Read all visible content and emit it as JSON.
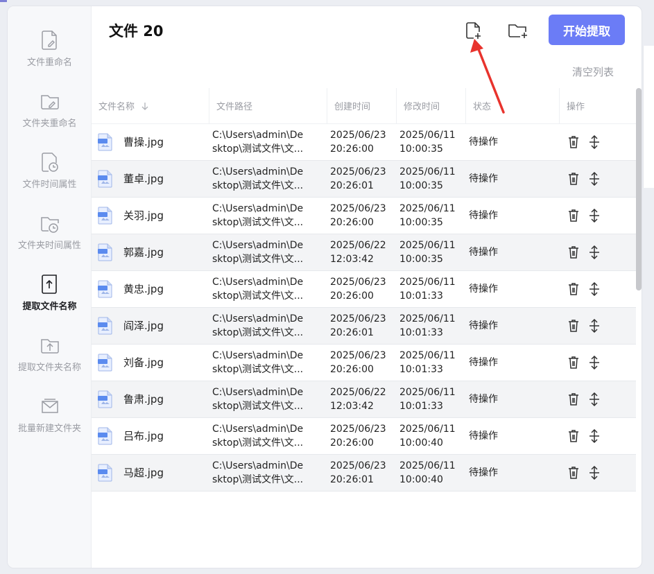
{
  "colors": {
    "accent": "#6b7cf6",
    "arrow": "#e8332d"
  },
  "sidebar": {
    "items": [
      {
        "label": "文件重命名",
        "icon": "file-edit-icon",
        "active": false
      },
      {
        "label": "文件夹重命名",
        "icon": "folder-edit-icon",
        "active": false
      },
      {
        "label": "文件时间属性",
        "icon": "file-clock-icon",
        "active": false
      },
      {
        "label": "文件夹时间属性",
        "icon": "folder-clock-icon",
        "active": false
      },
      {
        "label": "提取文件名称",
        "icon": "file-upload-icon",
        "active": true
      },
      {
        "label": "提取文件夹名称",
        "icon": "folder-upload-icon",
        "active": false
      },
      {
        "label": "批量新建文件夹",
        "icon": "mail-folder-icon",
        "active": false
      }
    ]
  },
  "header": {
    "title": "文件 20",
    "add_file_icon": "file-plus-icon",
    "add_folder_icon": "folder-plus-icon",
    "start_label": "开始提取",
    "clear_label": "清空列表"
  },
  "table": {
    "columns": [
      "文件名称",
      "文件路径",
      "创建时间",
      "修改时间",
      "状态",
      "操作"
    ],
    "rows": [
      {
        "name": "曹操.jpg",
        "path1": "C:\\Users\\admin\\De",
        "path2": "sktop\\测试文件\\文...",
        "created1": "2025/06/23",
        "created2": "20:26:00",
        "modified1": "2025/06/11",
        "modified2": "10:00:35",
        "status": "待操作"
      },
      {
        "name": "董卓.jpg",
        "path1": "C:\\Users\\admin\\De",
        "path2": "sktop\\测试文件\\文...",
        "created1": "2025/06/23",
        "created2": "20:26:01",
        "modified1": "2025/06/11",
        "modified2": "10:00:35",
        "status": "待操作"
      },
      {
        "name": "关羽.jpg",
        "path1": "C:\\Users\\admin\\De",
        "path2": "sktop\\测试文件\\文...",
        "created1": "2025/06/23",
        "created2": "20:26:00",
        "modified1": "2025/06/11",
        "modified2": "10:00:35",
        "status": "待操作"
      },
      {
        "name": "郭嘉.jpg",
        "path1": "C:\\Users\\admin\\De",
        "path2": "sktop\\测试文件\\文...",
        "created1": "2025/06/22",
        "created2": "12:03:42",
        "modified1": "2025/06/11",
        "modified2": "10:00:35",
        "status": "待操作"
      },
      {
        "name": "黄忠.jpg",
        "path1": "C:\\Users\\admin\\De",
        "path2": "sktop\\测试文件\\文...",
        "created1": "2025/06/23",
        "created2": "20:26:00",
        "modified1": "2025/06/11",
        "modified2": "10:01:33",
        "status": "待操作"
      },
      {
        "name": "阎泽.jpg",
        "path1": "C:\\Users\\admin\\De",
        "path2": "sktop\\测试文件\\文...",
        "created1": "2025/06/23",
        "created2": "20:26:01",
        "modified1": "2025/06/11",
        "modified2": "10:01:33",
        "status": "待操作"
      },
      {
        "name": "刘备.jpg",
        "path1": "C:\\Users\\admin\\De",
        "path2": "sktop\\测试文件\\文...",
        "created1": "2025/06/23",
        "created2": "20:26:00",
        "modified1": "2025/06/11",
        "modified2": "10:01:33",
        "status": "待操作"
      },
      {
        "name": "鲁肃.jpg",
        "path1": "C:\\Users\\admin\\De",
        "path2": "sktop\\测试文件\\文...",
        "created1": "2025/06/22",
        "created2": "12:03:42",
        "modified1": "2025/06/11",
        "modified2": "10:01:33",
        "status": "待操作"
      },
      {
        "name": "吕布.jpg",
        "path1": "C:\\Users\\admin\\De",
        "path2": "sktop\\测试文件\\文...",
        "created1": "2025/06/23",
        "created2": "20:26:00",
        "modified1": "2025/06/11",
        "modified2": "10:00:40",
        "status": "待操作"
      },
      {
        "name": "马超.jpg",
        "path1": "C:\\Users\\admin\\De",
        "path2": "sktop\\测试文件\\文...",
        "created1": "2025/06/23",
        "created2": "20:26:01",
        "modified1": "2025/06/11",
        "modified2": "10:00:40",
        "status": "待操作"
      }
    ]
  }
}
